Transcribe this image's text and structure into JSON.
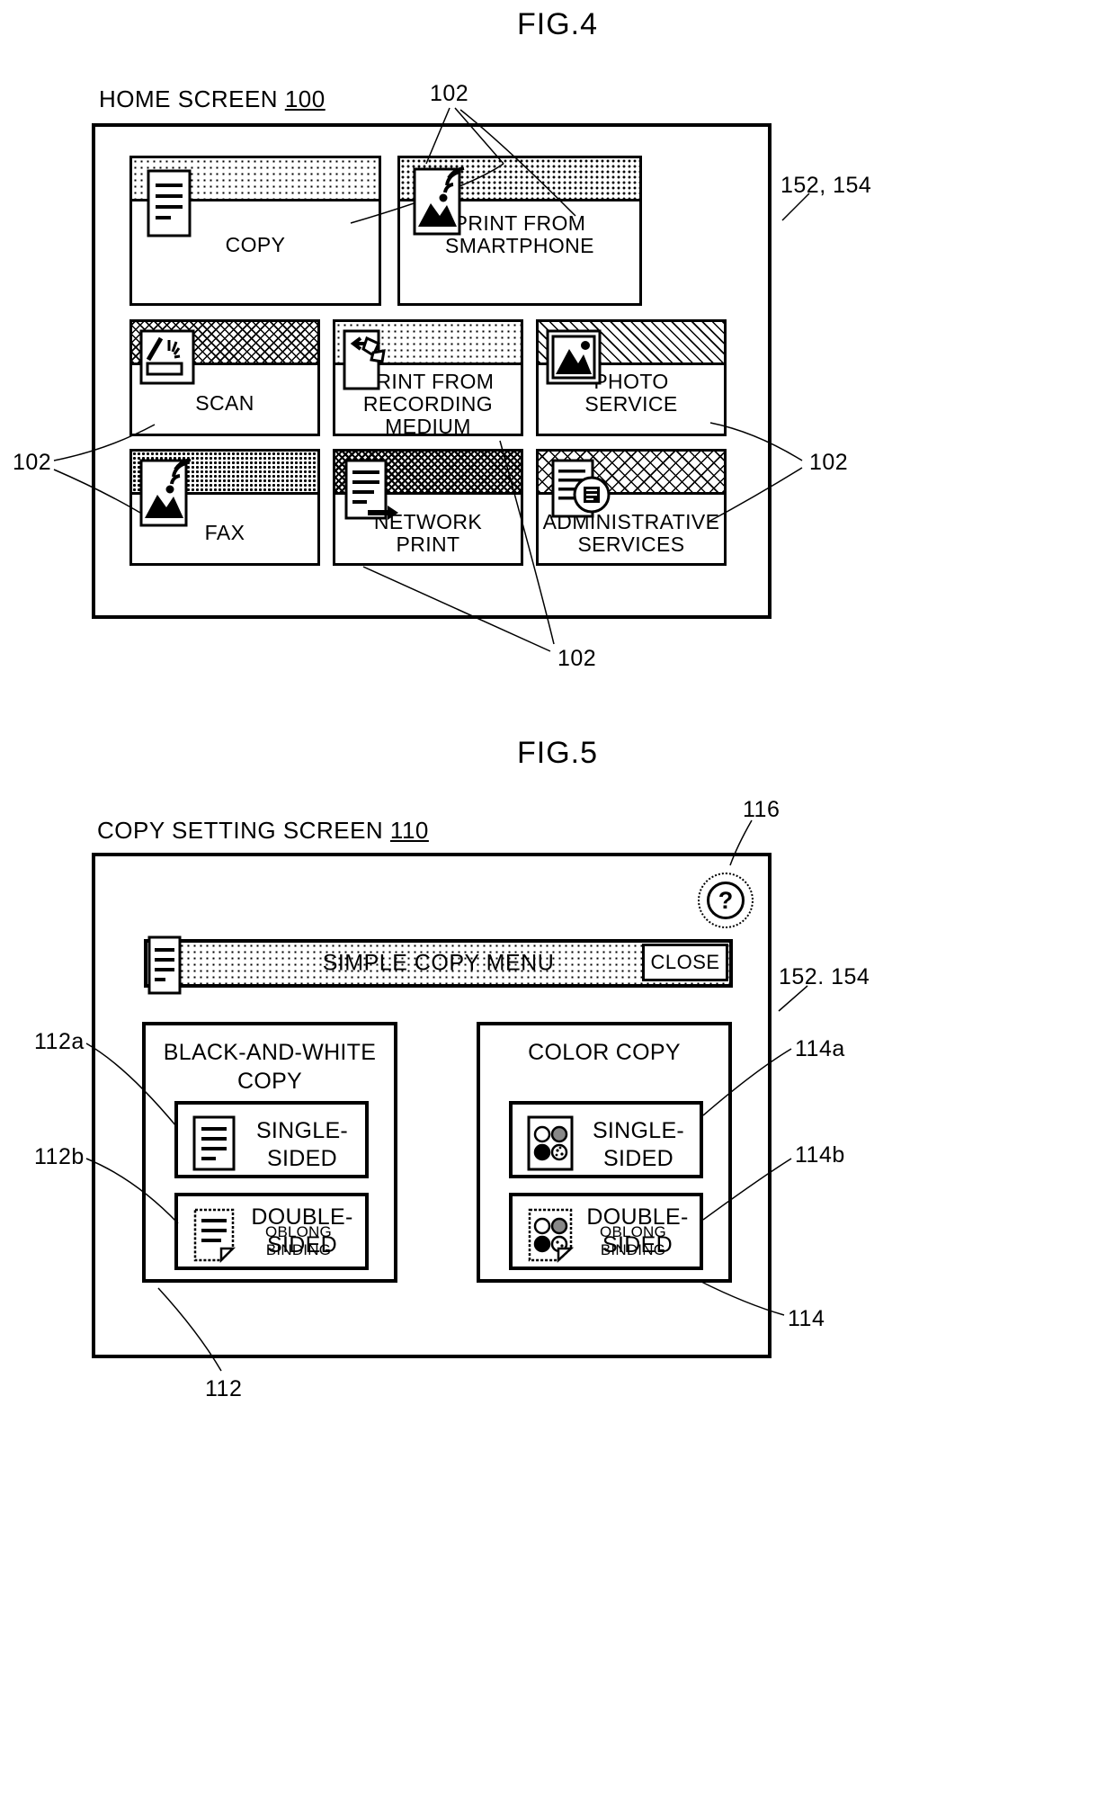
{
  "fig4": {
    "title": "FIG.4",
    "caption_text": "HOME SCREEN ",
    "caption_ref": "100",
    "ref_right": "152, 154",
    "ref_tile_top": "102",
    "ref_tile_left": "102",
    "ref_tile_right": "102",
    "ref_tile_bottom": "102",
    "tiles": [
      {
        "label": "COPY",
        "icon": "document-lines-icon",
        "pattern": "fill-dot-light"
      },
      {
        "label": "PRINT FROM\nSMARTPHONE",
        "icon": "photo-wireless-icon",
        "pattern": "fill-dot-med"
      },
      {
        "label": "SCAN",
        "icon": "scanner-icon",
        "pattern": "fill-cross"
      },
      {
        "label": "PRINT FROM\nRECORDING\nMEDIUM",
        "icon": "memory-card-arrow-icon",
        "pattern": "fill-dot-light"
      },
      {
        "label": "PHOTO\nSERVICE",
        "icon": "photo-frame-icon",
        "pattern": "fill-diag"
      },
      {
        "label": "FAX",
        "icon": "photo-wireless-icon",
        "pattern": "fill-dot-dense"
      },
      {
        "label": "NETWORK\nPRINT",
        "icon": "document-arrow-icon",
        "pattern": "fill-cross-dark"
      },
      {
        "label": "ADMINISTRATIVE\nSERVICES",
        "icon": "document-stamp-icon",
        "pattern": "fill-cross-open"
      }
    ]
  },
  "fig5": {
    "title": "FIG.5",
    "caption_text": "COPY SETTING SCREEN  ",
    "caption_ref": "110",
    "ref_help": "116",
    "ref_right": "152. 154",
    "ref_112a": "112a",
    "ref_112b": "112b",
    "ref_112": "112",
    "ref_114a": "114a",
    "ref_114b": "114b",
    "ref_114": "114",
    "help_glyph": "?",
    "menubar": {
      "title": "SIMPLE COPY MENU",
      "close_label": "CLOSE",
      "icon": "document-lines-icon",
      "pattern": "fill-dot-light"
    },
    "groups": [
      {
        "title": "BLACK-AND-WHITE\nCOPY",
        "options": [
          {
            "label": "SINGLE-\nSIDED",
            "sub": "",
            "icon": "bw-document-icon"
          },
          {
            "label": "DOUBLE-\nSIDED",
            "sub": "OBLONG BINDING",
            "icon": "bw-document-folded-icon"
          }
        ]
      },
      {
        "title": "COLOR COPY",
        "options": [
          {
            "label": "SINGLE-\nSIDED",
            "sub": "",
            "icon": "color-dots-icon"
          },
          {
            "label": "DOUBLE-\nSIDED",
            "sub": "OBLONG BINDING",
            "icon": "color-dots-folded-icon"
          }
        ]
      }
    ]
  }
}
